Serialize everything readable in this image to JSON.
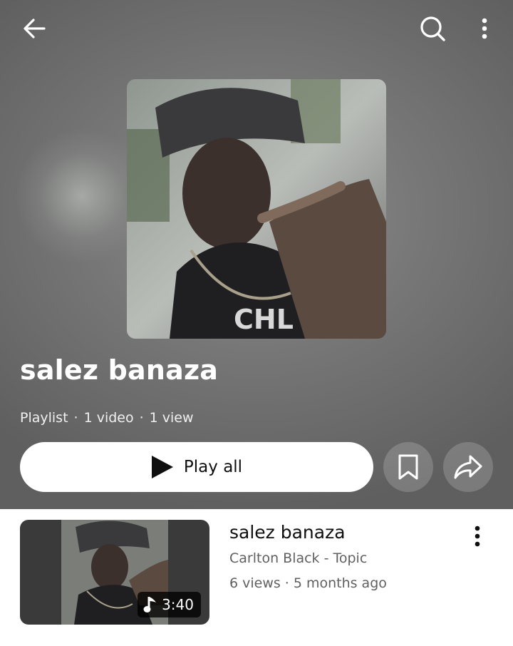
{
  "header": {
    "back_icon": "arrow-left-icon",
    "search_icon": "search-icon",
    "more_icon": "more-vert-icon"
  },
  "playlist": {
    "title": "salez banaza",
    "type": "Playlist",
    "video_count": "1 video",
    "view_count": "1 view",
    "play_all_label": "Play all",
    "save_icon": "bookmark-icon",
    "share_icon": "share-icon"
  },
  "videos": [
    {
      "title": "salez banaza",
      "channel": "Carlton Black - Topic",
      "views": "6 views",
      "age": "5 months ago",
      "duration": "3:40",
      "badge_icon": "music-note-icon"
    }
  ],
  "colors": {
    "header_bg": "#777777",
    "play_button_bg": "#ffffff",
    "primary_text": "#0f0f0f",
    "secondary_text": "#606060"
  }
}
